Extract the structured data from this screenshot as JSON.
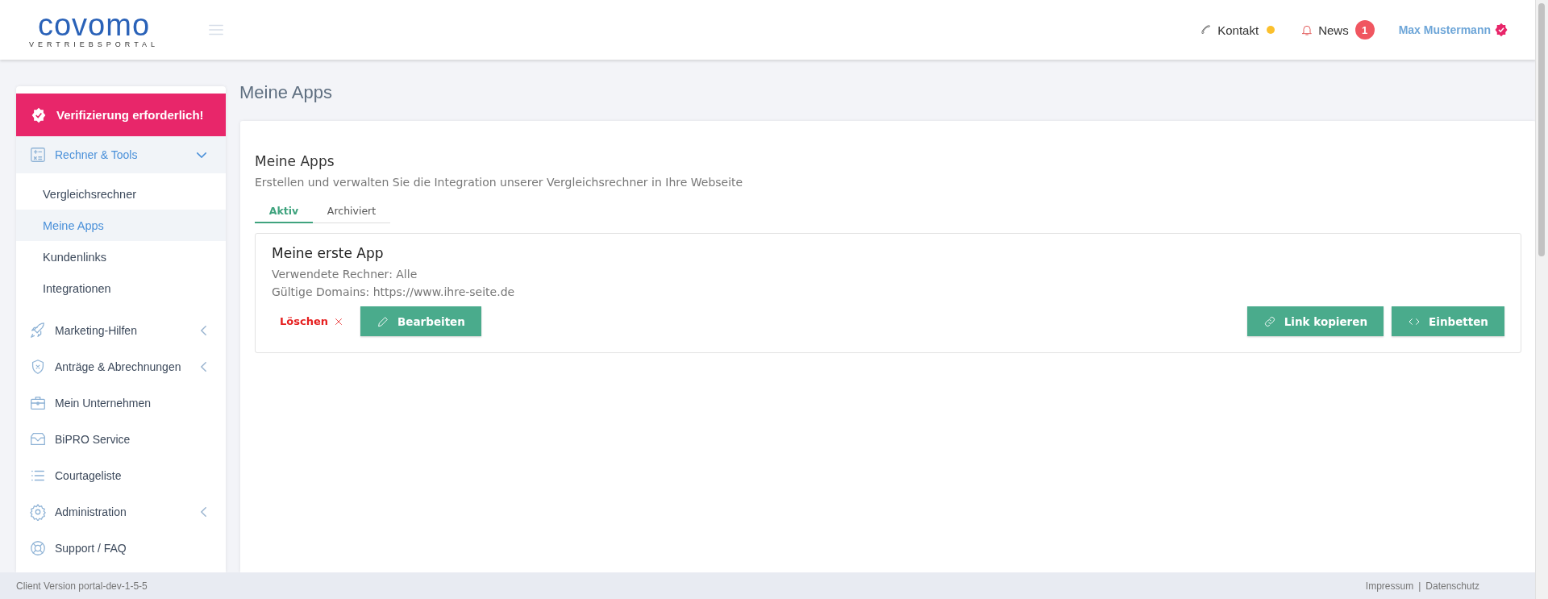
{
  "header": {
    "logo": {
      "name": "covomo",
      "tagline": "VERTRIEBSPORTAL"
    },
    "contact": {
      "label": "Kontakt",
      "color": "#fbc02d"
    },
    "news": {
      "label": "News",
      "badge": "1"
    },
    "user": {
      "name": "Max Mustermann"
    }
  },
  "sidebar": {
    "alert": "Verifizierung erforderlich!",
    "items": [
      {
        "kind": "group",
        "label": "Rechner & Tools",
        "expanded": true,
        "children": [
          {
            "label": "Vergleichsrechner",
            "selected": false
          },
          {
            "label": "Meine Apps",
            "selected": true
          },
          {
            "label": "Kundenlinks",
            "selected": false
          },
          {
            "label": "Integrationen",
            "selected": false
          }
        ]
      },
      {
        "kind": "group",
        "label": "Marketing-Hilfen",
        "expanded": false
      },
      {
        "kind": "group",
        "label": "Anträge & Abrechnungen",
        "expanded": false
      },
      {
        "kind": "link",
        "label": "Mein Unternehmen"
      },
      {
        "kind": "link",
        "label": "BiPRO Service"
      },
      {
        "kind": "link",
        "label": "Courtageliste"
      },
      {
        "kind": "group",
        "label": "Administration",
        "expanded": false
      },
      {
        "kind": "link",
        "label": "Support / FAQ"
      }
    ]
  },
  "page_title": "Meine Apps",
  "card": {
    "title": "Meine Apps",
    "description": "Erstellen und verwalten Sie die Integration unserer Vergleichsrechner in Ihre Webseite",
    "tabs": [
      {
        "label": "Aktiv",
        "selected": true
      },
      {
        "label": "Archiviert",
        "selected": false
      }
    ],
    "apps": [
      {
        "title": "Meine erste App",
        "lines": [
          "Verwendete Rechner: Alle",
          "Gültige Domains: https://www.ihre-seite.de"
        ],
        "delete": "Löschen",
        "edit": "Bearbeiten",
        "copy_link": "Link kopieren",
        "embed": "Einbetten"
      }
    ]
  },
  "footer": {
    "version": "Client Version portal-dev-1-5-5",
    "links": [
      "Impressum",
      "Datenschutz"
    ],
    "separator": "|"
  }
}
